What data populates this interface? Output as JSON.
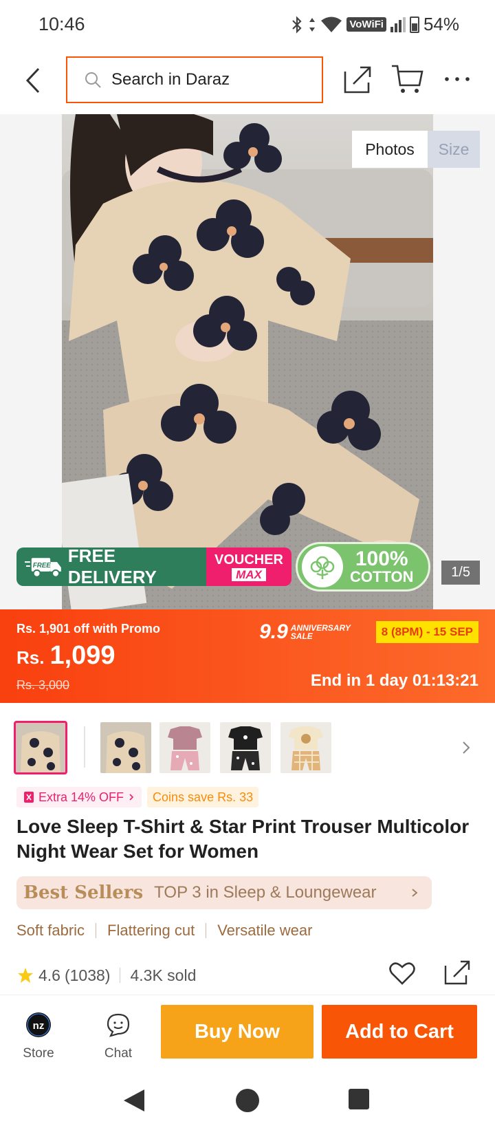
{
  "status_bar": {
    "time": "10:46",
    "network": "VoWiFi",
    "battery": "54%"
  },
  "topnav": {
    "search_placeholder": "Search in Daraz"
  },
  "gallery": {
    "tabs": [
      "Photos",
      "Size"
    ],
    "active_tab": "Photos",
    "counter": "1/5",
    "promo": {
      "free_delivery": "FREE DELIVERY",
      "free_tag": "FREE",
      "voucher_top": "VOUCHER",
      "voucher_bottom": "MAX",
      "cotton_pct": "100%",
      "cotton_label": "COTTON"
    }
  },
  "price": {
    "promo_off": "Rs. 1,901 off with Promo",
    "currency": "Rs.",
    "amount": "1,099",
    "original": "Rs. 3,000",
    "sale_number": "9.9",
    "sale_name": "ANNIVERSARY SALE",
    "sale_dates": "8 (8PM) - 15 SEP",
    "ends": "End in 1 day 01:13:21"
  },
  "variants": {
    "count": 5,
    "selected_index": 0
  },
  "badges": {
    "extra": "Extra 14% OFF",
    "coins": "Coins save Rs. 33"
  },
  "product": {
    "title": "Love Sleep T-Shirt & Star Print Trouser Multicolor Night Wear Set for Women",
    "best_sellers_title": "Best Sellers",
    "best_sellers_rank": "TOP 3 in Sleep & Loungewear",
    "features": [
      "Soft fabric",
      "Flattering cut",
      "Versatile wear"
    ],
    "rating": "4.6",
    "reviews": "(1038)",
    "sold": "4.3K sold"
  },
  "bottom_bar": {
    "store": "Store",
    "chat": "Chat",
    "buy_now": "Buy Now",
    "add_to_cart": "Add to Cart"
  },
  "colors": {
    "brand_orange": "#f85606",
    "buy_now": "#f6a31a",
    "accent_pink": "#ef1f6d"
  }
}
